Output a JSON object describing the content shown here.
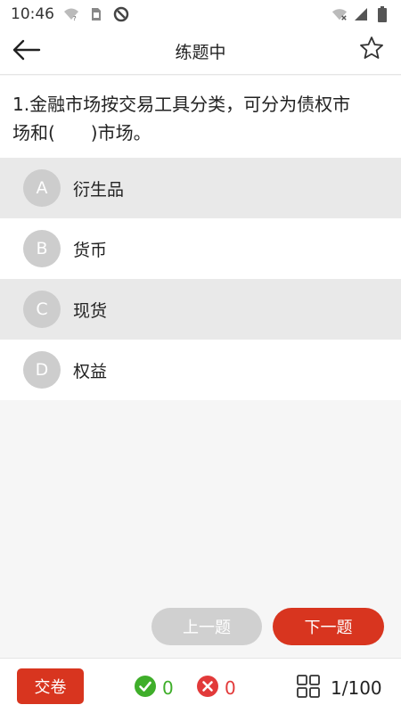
{
  "status_bar": {
    "time": "10:46",
    "icons": [
      "wifi-question-icon",
      "sim-card-icon",
      "data-saver-icon",
      "wifi-off-icon",
      "cell-signal-icon",
      "battery-icon"
    ]
  },
  "header": {
    "title": "练题中",
    "back_icon": "arrow-left-icon",
    "favorite_icon": "star-outline-icon"
  },
  "question": {
    "text_line1": "1.金融市场按交易工具分类，可分为债权市",
    "text_line2": "场和(　　)市场。"
  },
  "options": [
    {
      "letter": "A",
      "text": "衍生品"
    },
    {
      "letter": "B",
      "text": "货币"
    },
    {
      "letter": "C",
      "text": "现货"
    },
    {
      "letter": "D",
      "text": "权益"
    }
  ],
  "navigation": {
    "prev_label": "上一题",
    "next_label": "下一题"
  },
  "bottom_bar": {
    "submit_label": "交卷",
    "correct_count": "0",
    "wrong_count": "0",
    "progress": "1/100",
    "colors": {
      "accent": "#d8351f",
      "correct": "#3fae2a",
      "wrong": "#e23a3a"
    }
  }
}
